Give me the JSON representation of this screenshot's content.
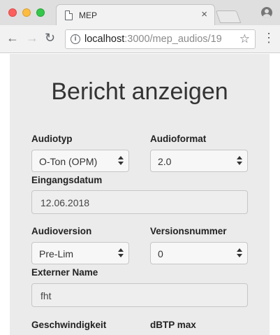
{
  "browser": {
    "tab_title": "MEP",
    "tab_close": "×",
    "url_host": "localhost",
    "url_rest": ":3000/mep_audios/19",
    "back_icon": "arrow-left-icon",
    "forward_icon": "arrow-right-icon",
    "reload_icon": "reload-icon",
    "bookmark_icon": "star-icon",
    "menu_icon": "vertical-dots-icon",
    "profile_icon": "user-icon"
  },
  "page": {
    "title": "Bericht anzeigen",
    "fields": {
      "audiotyp": {
        "label": "Audiotyp",
        "value": "O-Ton (OPM)"
      },
      "audioformat": {
        "label": "Audioformat",
        "value": "2.0"
      },
      "eingangsdatum": {
        "label": "Eingangsdatum",
        "value": "12.06.2018"
      },
      "audioversion": {
        "label": "Audioversion",
        "value": "Pre-Lim"
      },
      "versionsnummer": {
        "label": "Versionsnummer",
        "value": "0"
      },
      "externer_name": {
        "label": "Externer Name",
        "value": "fht"
      },
      "geschwindigkeit": {
        "label": "Geschwindigkeit"
      },
      "dbtp_max": {
        "label": "dBTP max"
      }
    }
  },
  "colors": {
    "panel_bg": "#ebebeb",
    "tab_bar_bg": "#dfdfdf",
    "close_red": "#fc605c",
    "minimize_yellow": "#fdbc40",
    "zoom_green": "#34c84a"
  }
}
